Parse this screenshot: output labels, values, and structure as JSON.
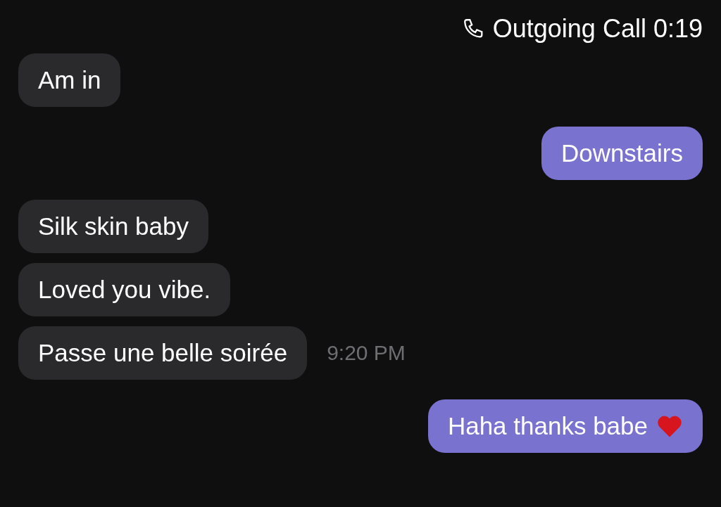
{
  "call": {
    "label": "Outgoing Call",
    "duration": "0:19"
  },
  "messages": [
    {
      "kind": "incoming",
      "text": "Am in",
      "heart": false
    },
    {
      "kind": "outgoing",
      "text": "Downstairs",
      "heart": false
    },
    {
      "kind": "incoming",
      "text": "Silk skin baby",
      "heart": false
    },
    {
      "kind": "incoming",
      "text": "Loved you vibe.",
      "heart": false
    },
    {
      "kind": "incoming",
      "text": "Passe une belle soirée",
      "time": "9:20 PM",
      "heart": false
    },
    {
      "kind": "outgoing",
      "text": "Haha thanks babe",
      "heart": true
    }
  ]
}
